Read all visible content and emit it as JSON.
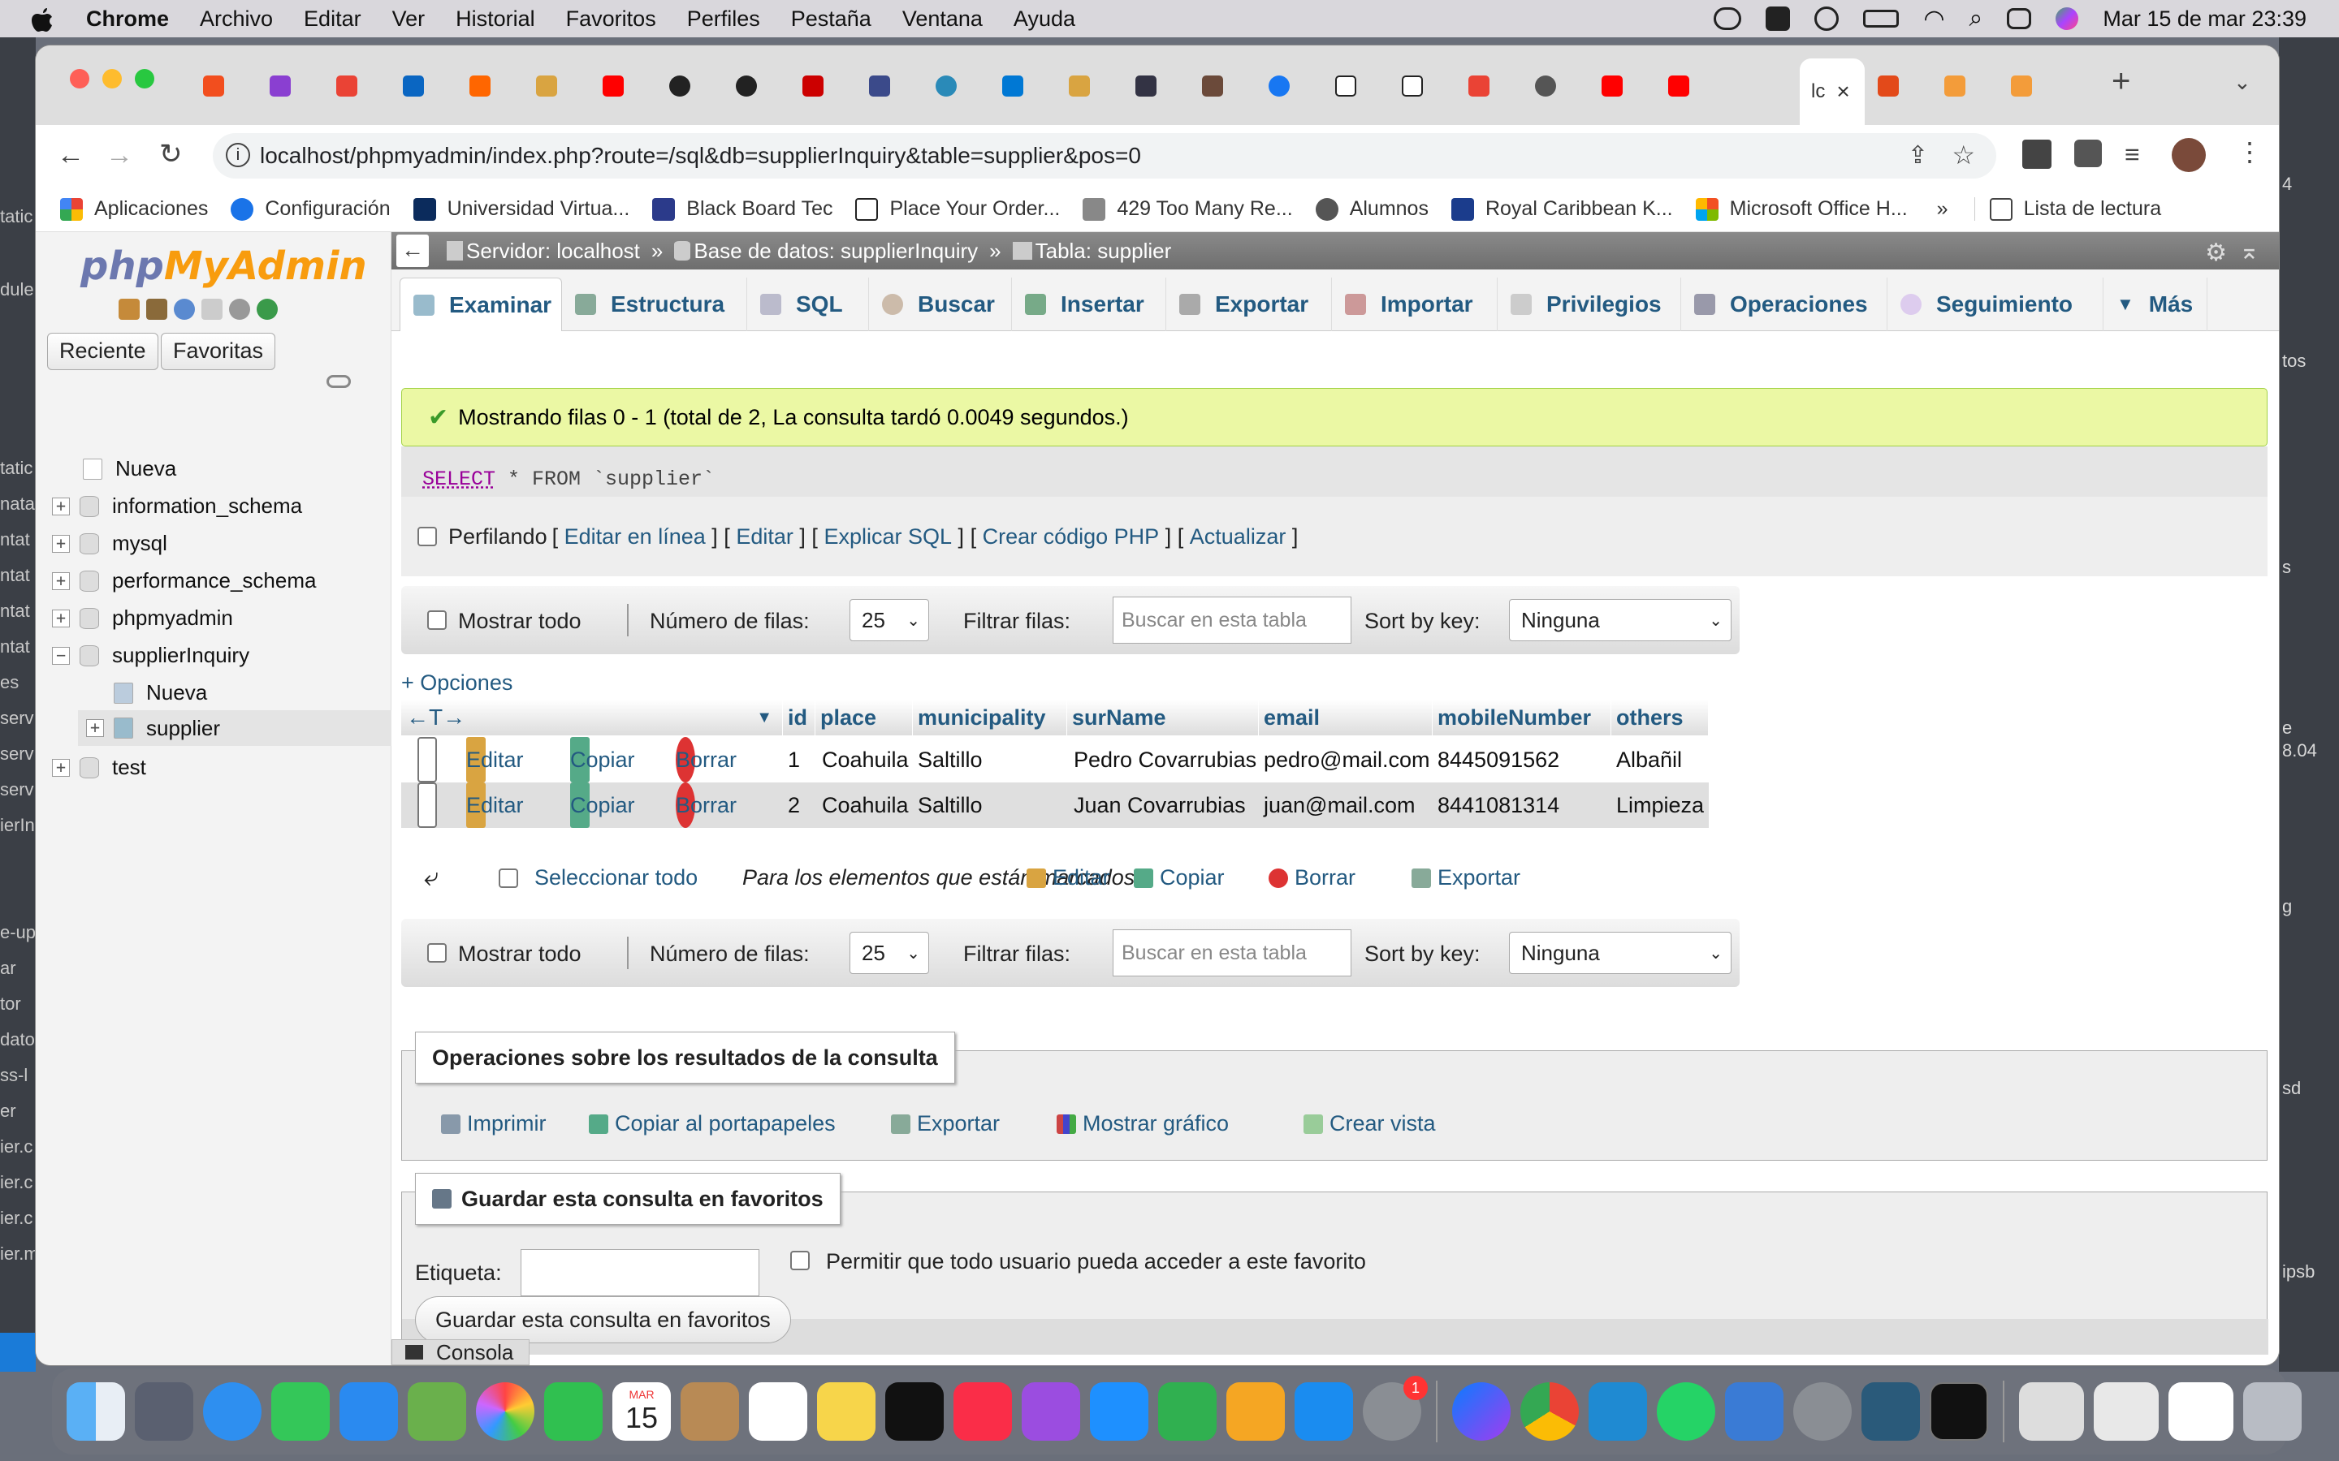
{
  "menubar": {
    "app": "Chrome",
    "items": [
      "Archivo",
      "Editar",
      "Ver",
      "Historial",
      "Favoritos",
      "Perfiles",
      "Pestaña",
      "Ventana",
      "Ayuda"
    ],
    "clock": "Mar 15 de mar  23:39"
  },
  "browser": {
    "active_tab": "lc",
    "url": "localhost/phpmyadmin/index.php?route=/sql&db=supplierInquiry&table=supplier&pos=0",
    "bookmarks": [
      "Aplicaciones",
      "Configuración",
      "Universidad Virtua...",
      "Black Board Tec",
      "Place Your Order...",
      "429 Too Many Re...",
      "Alumnos",
      "Royal Caribbean K...",
      "Microsoft Office H..."
    ],
    "overflow": "»",
    "reading_list": "Lista de lectura"
  },
  "sidebar": {
    "logo_a": "php",
    "logo_b": "MyAdmin",
    "recent": "Reciente",
    "favorites": "Favoritas",
    "tree": [
      {
        "label": "Nueva"
      },
      {
        "label": "information_schema"
      },
      {
        "label": "mysql"
      },
      {
        "label": "performance_schema"
      },
      {
        "label": "phpmyadmin"
      },
      {
        "label": "supplierInquiry"
      },
      {
        "label": "Nueva"
      },
      {
        "label": "supplier"
      },
      {
        "label": "test"
      }
    ]
  },
  "breadcrumb": {
    "server": "Servidor: localhost",
    "db": "Base de datos: supplierInquiry",
    "table": "Tabla: supplier",
    "sep": "»"
  },
  "tabs": [
    {
      "label": "Examinar"
    },
    {
      "label": "Estructura"
    },
    {
      "label": "SQL"
    },
    {
      "label": "Buscar"
    },
    {
      "label": "Insertar"
    },
    {
      "label": "Exportar"
    },
    {
      "label": "Importar"
    },
    {
      "label": "Privilegios"
    },
    {
      "label": "Operaciones"
    },
    {
      "label": "Seguimiento"
    },
    {
      "label": "Más"
    }
  ],
  "result": {
    "message": "Mostrando filas 0 - 1 (total de 2, La consulta tardó 0.0049 segundos.)",
    "sql_kw": "SELECT",
    "sql_rest": " * FROM `supplier`",
    "profiling": "Perfilando",
    "links": [
      "Editar en línea",
      "Editar",
      "Explicar SQL",
      "Crear código PHP",
      "Actualizar"
    ]
  },
  "nav": {
    "show_all": "Mostrar todo",
    "rows_label": "Número de filas:",
    "rows_value": "25",
    "filter_label": "Filtrar filas:",
    "filter_placeholder": "Buscar en esta tabla",
    "sort_label": "Sort by key:",
    "sort_value": "Ninguna"
  },
  "options_link": "+ Opciones",
  "table": {
    "columns": [
      "id",
      "place",
      "municipality",
      "surName",
      "email",
      "mobileNumber",
      "others"
    ],
    "actions": {
      "edit": "Editar",
      "copy": "Copiar",
      "delete": "Borrar"
    },
    "rows": [
      {
        "id": "1",
        "place": "Coahuila",
        "municipality": "Saltillo",
        "surName": "Pedro Covarrubias",
        "email": "pedro@mail.com",
        "mobileNumber": "8445091562",
        "others": "Albañil"
      },
      {
        "id": "2",
        "place": "Coahuila",
        "municipality": "Saltillo",
        "surName": "Juan Covarrubias",
        "email": "juan@mail.com",
        "mobileNumber": "8441081314",
        "others": "Limpieza"
      }
    ]
  },
  "bulk": {
    "select_all": "Seleccionar todo",
    "marked": "Para los elementos que están marcados:",
    "edit": "Editar",
    "copy": "Copiar",
    "delete": "Borrar",
    "export": "Exportar"
  },
  "ops": {
    "title": "Operaciones sobre los resultados de la consulta",
    "print": "Imprimir",
    "clipboard": "Copiar al portapapeles",
    "export": "Exportar",
    "chart": "Mostrar gráfico",
    "view": "Crear vista"
  },
  "bookmark": {
    "title": "Guardar esta consulta en favoritos",
    "label": "Etiqueta:",
    "allow": "Permitir que todo usuario pueda acceder a este favorito",
    "button": "Guardar esta consulta en favoritos"
  },
  "console": "Consola",
  "dock_date": {
    "month": "MAR",
    "day": "15"
  },
  "dock_badge": "1",
  "left_strip": [
    "tatic",
    "dule",
    "tatic",
    "nata",
    "ntat",
    "ntat",
    "ntat",
    "ntat",
    "es",
    "serv",
    "serv",
    "serv",
    "ierIn",
    "e-up",
    "ar",
    "tor",
    "dato",
    "ss-l",
    "er",
    "ier.c",
    "ier.c",
    "ier.c",
    "ier.m"
  ],
  "right_strip": [
    "4",
    "tos",
    "s",
    "e",
    "8.04",
    "g",
    "sd",
    "ipsb"
  ],
  "colors": {
    "accent": "#235a81",
    "success_bg": "#ebf8a4",
    "logo_blue": "#6c78af",
    "logo_orange": "#f89c0e"
  }
}
